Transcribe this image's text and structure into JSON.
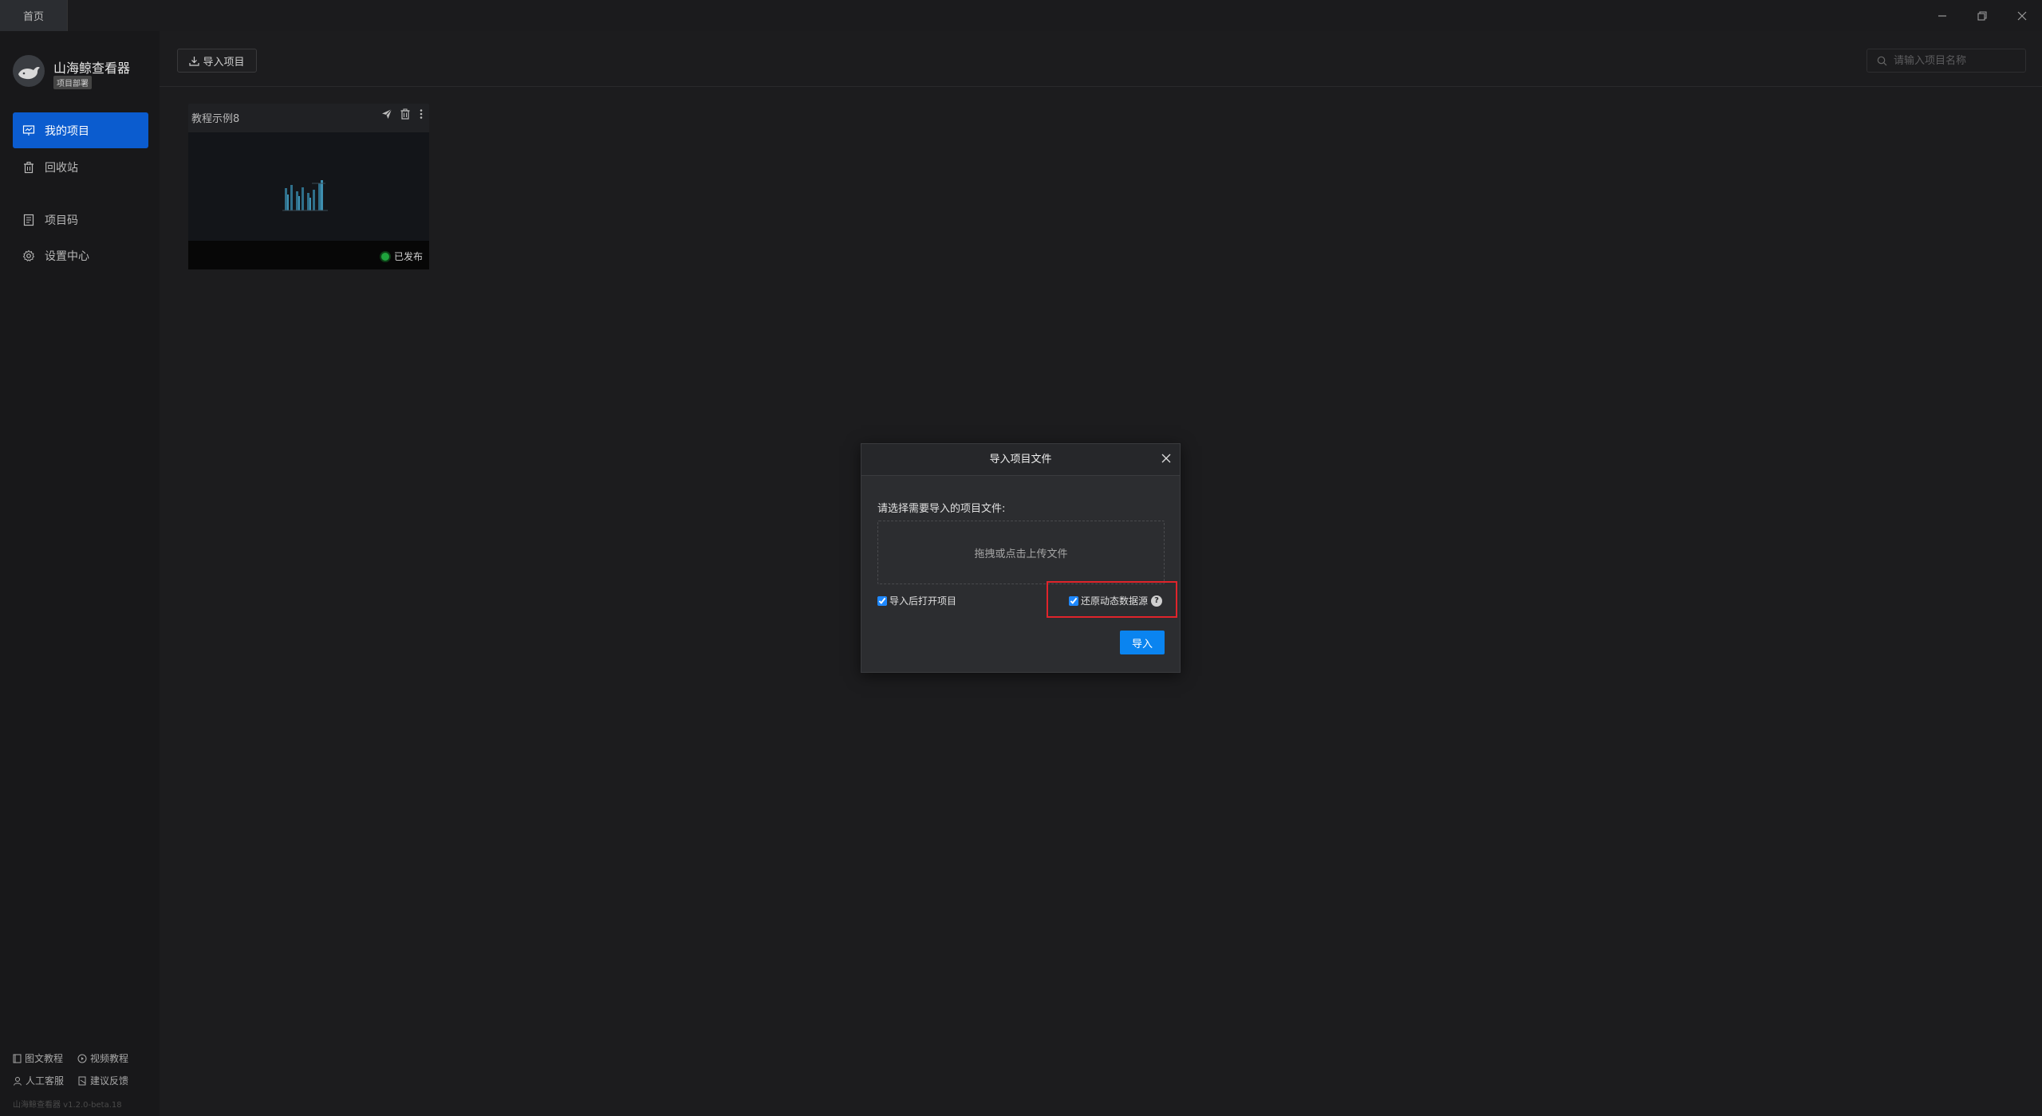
{
  "titlebar": {
    "tab_home": "首页",
    "controls": {
      "minimize_icon": "minimize-icon",
      "restore_icon": "restore-icon",
      "close_icon": "close-icon"
    }
  },
  "sidebar": {
    "brand_name": "山海鲸查看器",
    "brand_badge": "项目部署",
    "items": [
      {
        "label": "我的项目",
        "icon": "presentation-icon",
        "active": true
      },
      {
        "label": "回收站",
        "icon": "trash-icon",
        "active": false
      },
      {
        "label": "项目码",
        "icon": "document-icon",
        "active": false
      },
      {
        "label": "设置中心",
        "icon": "gear-icon",
        "active": false
      }
    ],
    "footer": {
      "doc_tutorial": "图文教程",
      "video_tutorial": "视频教程",
      "support": "人工客服",
      "feedback": "建议反馈",
      "version": "山海鲸查看器 v1.2.0-beta.18"
    }
  },
  "main": {
    "import_button": "导入项目",
    "search_placeholder": "请输入项目名称",
    "projects": [
      {
        "title": "教程示例8",
        "status": "已发布"
      }
    ]
  },
  "modal": {
    "title": "导入项目文件",
    "prompt": "请选择需要导入的项目文件:",
    "dropzone_text": "拖拽或点击上传文件",
    "checkbox_open_after": {
      "label": "导入后打开项目",
      "checked": true
    },
    "checkbox_restore_datasource": {
      "label": "还原动态数据源",
      "checked": true
    },
    "submit_button": "导入"
  },
  "colors": {
    "accent": "#0b5ccf",
    "button_primary": "#0a84f0",
    "highlight_border": "#e0242b",
    "status_published": "#1fa33d"
  }
}
